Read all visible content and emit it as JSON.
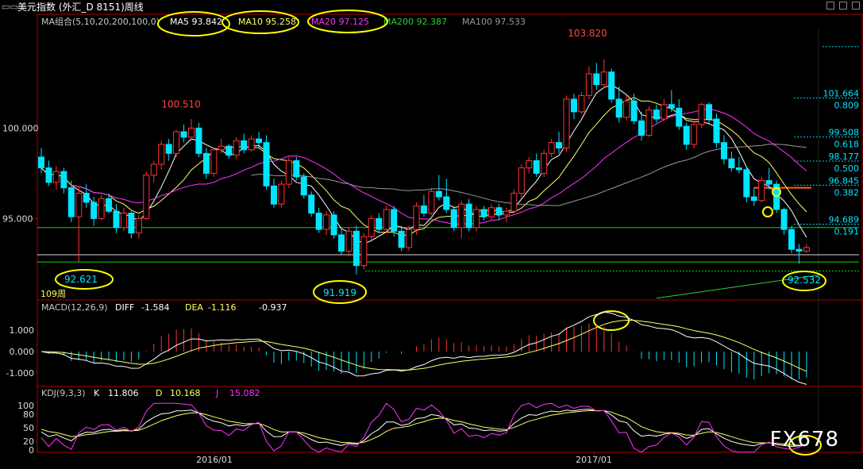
{
  "window": {
    "title": "美元指数 (外汇_D 8151)周线"
  },
  "main_panel": {
    "legend": [
      {
        "label": "MA组合(5,10,20,200,100,0)",
        "color": "#c8c8c8"
      },
      {
        "label": "MA5 93.842",
        "color": "#ffffff"
      },
      {
        "label": "MA10 95.258",
        "color": "#ffff66"
      },
      {
        "label": "MA20 97.125",
        "color": "#ff33ff"
      },
      {
        "label": "MA200 92.387",
        "color": "#33cc33"
      },
      {
        "label": "MA100 97.533",
        "color": "#999999"
      }
    ],
    "y_ticks": [
      "100.000",
      "95.000"
    ],
    "fib_levels": [
      {
        "price": "101.664",
        "ratio": "0.809"
      },
      {
        "price": "99.508",
        "ratio": "0.618"
      },
      {
        "price": "98.177",
        "ratio": "0.500"
      },
      {
        "price": "96.845",
        "ratio": "0.382"
      },
      {
        "price": "94.689",
        "ratio": "0.191"
      }
    ],
    "annotations": {
      "high_2016": "100.510",
      "high_2017": "103.820",
      "low_left": "92.621",
      "low_mid": "91.919",
      "low_right": "92.532",
      "period_count": "109周"
    }
  },
  "macd_panel": {
    "legend": [
      {
        "label": "MACD(12,26,9)",
        "color": "#c8c8c8"
      },
      {
        "label": "DIFF",
        "color": "#ffffff"
      },
      {
        "label": "-1.584",
        "color": "#ffffff"
      },
      {
        "label": "DEA",
        "color": "#ffff66"
      },
      {
        "label": "-1.116",
        "color": "#ffff66"
      },
      {
        "label": "-0.937",
        "color": "#ffffff"
      }
    ],
    "y_ticks": [
      "1.000",
      "0.000",
      "-1.000"
    ]
  },
  "kdj_panel": {
    "legend": [
      {
        "label": "KDJ(9,3,3)",
        "color": "#c8c8c8"
      },
      {
        "label": "K",
        "color": "#ffffff"
      },
      {
        "label": "11.806",
        "color": "#ffffff"
      },
      {
        "label": "D",
        "color": "#ffff66"
      },
      {
        "label": "10.168",
        "color": "#ffff66"
      },
      {
        "label": "J",
        "color": "#ff33ff"
      },
      {
        "label": "15.082",
        "color": "#ff33ff"
      }
    ],
    "y_ticks": [
      "100",
      "80",
      "50",
      "20",
      "0"
    ]
  },
  "x_axis": {
    "labels": [
      "2016/01",
      "2017/01"
    ]
  },
  "watermark": "FX678",
  "colors": {
    "up": "#ff3333",
    "down": "#00e5ff",
    "axis": "#b00000",
    "support": "#00dd00",
    "highlight": "#ffff00",
    "resistance": "#ff6600"
  },
  "chart_data": {
    "type": "candlestick",
    "title": "美元指数 (外汇_D 8151)周线",
    "ylim": [
      90.5,
      105.5
    ],
    "ohlc": [
      [
        98.4,
        98.9,
        97.5,
        97.8
      ],
      [
        97.8,
        98.2,
        96.8,
        97.0
      ],
      [
        97.0,
        97.9,
        96.6,
        97.6
      ],
      [
        97.6,
        97.8,
        96.4,
        96.7
      ],
      [
        96.7,
        97.1,
        94.8,
        95.1
      ],
      [
        95.1,
        96.8,
        92.6,
        96.4
      ],
      [
        96.4,
        96.9,
        95.6,
        95.9
      ],
      [
        95.9,
        96.2,
        94.6,
        95.0
      ],
      [
        95.0,
        96.3,
        94.9,
        96.1
      ],
      [
        96.1,
        96.4,
        95.3,
        95.4
      ],
      [
        95.4,
        95.8,
        94.2,
        94.5
      ],
      [
        94.5,
        95.6,
        94.3,
        95.3
      ],
      [
        95.3,
        95.4,
        93.9,
        94.2
      ],
      [
        94.2,
        95.2,
        93.9,
        95.0
      ],
      [
        95.0,
        97.6,
        94.9,
        97.4
      ],
      [
        97.4,
        98.2,
        97.0,
        98.0
      ],
      [
        98.0,
        99.3,
        97.7,
        99.1
      ],
      [
        99.1,
        99.4,
        98.2,
        98.6
      ],
      [
        98.6,
        99.9,
        98.4,
        99.8
      ],
      [
        99.8,
        100.2,
        99.2,
        99.5
      ],
      [
        99.5,
        100.5,
        99.3,
        100.0
      ],
      [
        100.0,
        100.3,
        98.4,
        98.6
      ],
      [
        98.6,
        98.9,
        97.2,
        97.5
      ],
      [
        97.5,
        98.9,
        97.3,
        98.8
      ],
      [
        98.8,
        99.4,
        98.6,
        99.0
      ],
      [
        99.0,
        99.1,
        98.3,
        98.5
      ],
      [
        98.5,
        99.5,
        98.3,
        99.3
      ],
      [
        99.3,
        99.7,
        98.6,
        98.8
      ],
      [
        98.8,
        99.6,
        98.7,
        99.4
      ],
      [
        99.4,
        99.8,
        98.9,
        99.2
      ],
      [
        99.2,
        99.6,
        96.6,
        96.8
      ],
      [
        96.8,
        97.2,
        95.6,
        95.8
      ],
      [
        95.8,
        97.1,
        95.6,
        96.9
      ],
      [
        96.9,
        98.4,
        96.7,
        98.2
      ],
      [
        98.2,
        98.4,
        97.1,
        97.3
      ],
      [
        97.3,
        97.5,
        96.1,
        96.3
      ],
      [
        96.3,
        96.5,
        95.1,
        95.3
      ],
      [
        95.3,
        95.6,
        94.2,
        94.4
      ],
      [
        94.4,
        95.4,
        94.1,
        95.2
      ],
      [
        95.2,
        95.4,
        93.9,
        94.1
      ],
      [
        94.1,
        94.4,
        93.0,
        93.2
      ],
      [
        93.2,
        94.5,
        92.9,
        94.3
      ],
      [
        94.3,
        94.6,
        91.9,
        92.4
      ],
      [
        92.4,
        94.2,
        92.2,
        94.0
      ],
      [
        94.0,
        95.2,
        93.8,
        95.0
      ],
      [
        95.0,
        95.3,
        94.2,
        94.4
      ],
      [
        94.4,
        95.7,
        94.2,
        95.5
      ],
      [
        95.5,
        95.7,
        94.0,
        94.3
      ],
      [
        94.3,
        94.6,
        93.2,
        93.4
      ],
      [
        93.4,
        94.6,
        93.2,
        94.4
      ],
      [
        94.4,
        95.9,
        94.1,
        95.7
      ],
      [
        95.7,
        96.3,
        95.1,
        95.3
      ],
      [
        95.3,
        96.7,
        95.2,
        96.5
      ],
      [
        96.5,
        97.4,
        96.0,
        96.2
      ],
      [
        96.2,
        97.2,
        95.3,
        95.5
      ],
      [
        95.5,
        95.7,
        94.3,
        94.5
      ],
      [
        94.5,
        96.0,
        93.9,
        95.8
      ],
      [
        95.8,
        96.1,
        94.3,
        94.5
      ],
      [
        94.5,
        95.7,
        94.3,
        95.5
      ],
      [
        95.5,
        95.7,
        94.9,
        95.1
      ],
      [
        95.1,
        95.8,
        94.9,
        95.6
      ],
      [
        95.6,
        95.8,
        94.9,
        95.2
      ],
      [
        95.2,
        95.6,
        94.8,
        95.4
      ],
      [
        95.4,
        96.6,
        95.3,
        96.4
      ],
      [
        96.4,
        98.0,
        96.2,
        97.8
      ],
      [
        97.8,
        98.4,
        97.5,
        98.2
      ],
      [
        98.2,
        98.6,
        97.3,
        97.5
      ],
      [
        97.5,
        98.8,
        97.3,
        98.6
      ],
      [
        98.6,
        99.4,
        98.4,
        99.2
      ],
      [
        99.2,
        99.8,
        98.6,
        98.9
      ],
      [
        98.9,
        101.8,
        98.7,
        101.6
      ],
      [
        101.6,
        101.9,
        100.5,
        100.9
      ],
      [
        100.9,
        102.0,
        100.8,
        101.8
      ],
      [
        101.8,
        103.4,
        101.6,
        103.0
      ],
      [
        103.0,
        103.6,
        102.1,
        102.4
      ],
      [
        102.4,
        103.8,
        102.2,
        103.1
      ],
      [
        103.1,
        103.3,
        101.4,
        101.6
      ],
      [
        101.6,
        102.3,
        100.3,
        100.6
      ],
      [
        100.6,
        101.8,
        100.4,
        101.5
      ],
      [
        101.5,
        101.9,
        100.2,
        100.4
      ],
      [
        100.4,
        100.9,
        99.3,
        99.6
      ],
      [
        99.6,
        101.2,
        99.5,
        101.0
      ],
      [
        101.0,
        101.3,
        100.3,
        100.5
      ],
      [
        100.5,
        101.6,
        100.4,
        101.3
      ],
      [
        101.3,
        102.1,
        100.9,
        101.1
      ],
      [
        101.1,
        101.6,
        99.9,
        100.1
      ],
      [
        100.1,
        100.3,
        98.8,
        99.1
      ],
      [
        99.1,
        100.4,
        98.9,
        100.2
      ],
      [
        100.2,
        101.4,
        100.0,
        101.3
      ],
      [
        101.3,
        101.4,
        100.2,
        100.5
      ],
      [
        100.5,
        100.8,
        98.9,
        99.2
      ],
      [
        99.2,
        99.6,
        98.0,
        98.3
      ],
      [
        98.3,
        98.7,
        97.6,
        97.8
      ],
      [
        97.8,
        98.4,
        97.5,
        97.7
      ],
      [
        97.7,
        97.9,
        95.9,
        96.2
      ],
      [
        96.2,
        96.7,
        95.7,
        96.0
      ],
      [
        96.0,
        97.3,
        95.9,
        97.1
      ],
      [
        97.1,
        97.8,
        96.6,
        96.9
      ],
      [
        96.9,
        97.1,
        95.3,
        95.5
      ],
      [
        95.5,
        95.6,
        94.1,
        94.4
      ],
      [
        94.4,
        94.6,
        93.1,
        93.3
      ],
      [
        93.3,
        93.6,
        92.5,
        93.2
      ],
      [
        93.2,
        93.6,
        93.1,
        93.4
      ]
    ]
  }
}
